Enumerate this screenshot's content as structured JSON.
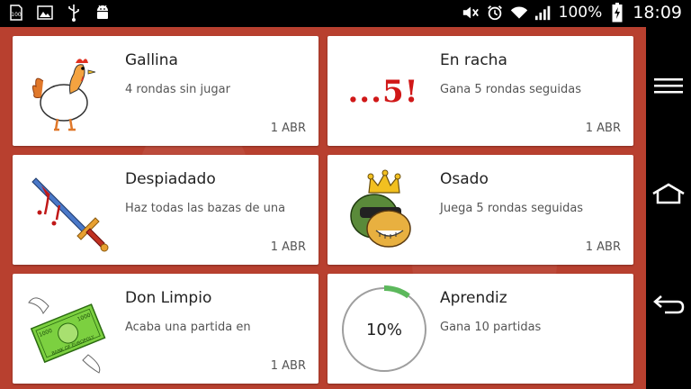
{
  "status_bar": {
    "left_icons": [
      "sim-card-icon",
      "image-icon",
      "usb-icon",
      "android-debug-icon"
    ],
    "right_icons": [
      "mute-icon",
      "alarm-icon",
      "wifi-icon",
      "signal-icon"
    ],
    "battery_percent": "100%",
    "time": "18:09"
  },
  "achievements": [
    {
      "title": "Gallina",
      "desc": "4 rondas sin jugar",
      "date": "1 ABR",
      "icon": "chicken-icon"
    },
    {
      "title": "En racha",
      "desc": "Gana 5 rondas seguidas",
      "date": "1 ABR",
      "icon": "streak-five-icon",
      "badge_text": "...5!"
    },
    {
      "title": "Despiadado",
      "desc": "Haz todas las bazas de una",
      "date": "1 ABR",
      "icon": "bloody-sword-icon"
    },
    {
      "title": "Osado",
      "desc": "Juega 5 rondas seguidas",
      "date": "1 ABR",
      "icon": "crowned-biker-icon"
    },
    {
      "title": "Don Limpio",
      "desc": "Acaba una partida en",
      "date": "1 ABR",
      "icon": "winged-banknote-icon",
      "banknote": {
        "value": "1000",
        "bank": "BANK OF EUROPOLY"
      }
    },
    {
      "title": "Aprendiz",
      "desc": "Gana 10 partidas",
      "progress_label": "10%",
      "progress": 0.1,
      "icon": "progress-ring-icon"
    }
  ],
  "nav_bar": {
    "buttons": [
      "menu-icon",
      "home-icon",
      "back-icon"
    ]
  },
  "colors": {
    "background": "#b8402f",
    "card": "#ffffff",
    "progress": "#5cb85c",
    "progress_track": "#9e9e9e",
    "streak_red": "#d01818"
  }
}
